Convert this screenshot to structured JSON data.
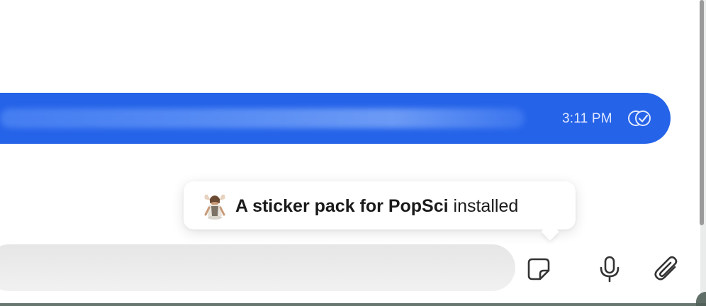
{
  "message": {
    "time": "3:11 PM",
    "status_icon": "double-check-read-icon"
  },
  "toast": {
    "sticker_icon": "sticker-thumbnail",
    "title_bold": "A sticker pack for PopSci",
    "title_suffix": " installed"
  },
  "composer": {
    "placeholder": "",
    "icons": [
      "sticker-icon",
      "microphone-icon",
      "paperclip-icon"
    ]
  },
  "colors": {
    "bubble": "#2563e8",
    "toast_bg": "#ffffff",
    "input_bg": "#ececec",
    "icon": "#333333"
  }
}
